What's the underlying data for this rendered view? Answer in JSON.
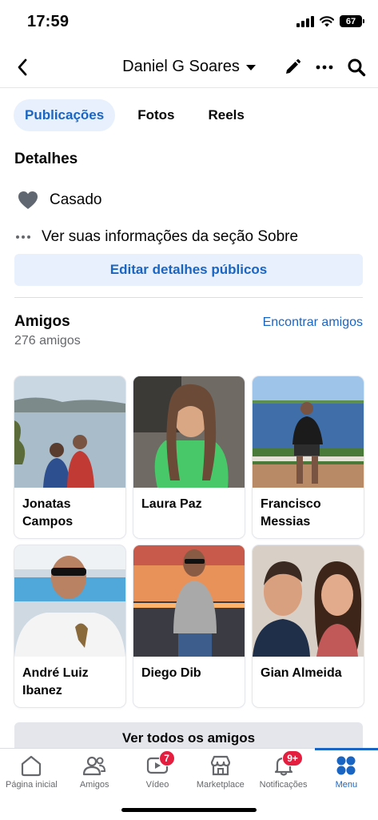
{
  "status_bar": {
    "time": "17:59",
    "battery": "67"
  },
  "header": {
    "name": "Daniel G Soares"
  },
  "tabs": [
    {
      "label": "Publicações",
      "active": true
    },
    {
      "label": "Fotos",
      "active": false
    },
    {
      "label": "Reels",
      "active": false
    }
  ],
  "details": {
    "title": "Detalhes",
    "relationship": "Casado",
    "about_link": "Ver suas informações da seção Sobre",
    "edit_button": "Editar detalhes públicos"
  },
  "friends": {
    "title": "Amigos",
    "count": "276 amigos",
    "find_link": "Encontrar amigos",
    "list": [
      {
        "name": "Jonatas Campos"
      },
      {
        "name": "Laura Paz"
      },
      {
        "name": "Francisco Messias"
      },
      {
        "name": "André Luiz Ibanez"
      },
      {
        "name": "Diego Dib"
      },
      {
        "name": "Gian Almeida"
      }
    ],
    "see_all": "Ver todos os amigos"
  },
  "bottom_nav": [
    {
      "label": "Página inicial",
      "icon": "home-icon"
    },
    {
      "label": "Amigos",
      "icon": "friends-icon"
    },
    {
      "label": "Vídeo",
      "icon": "video-icon",
      "badge": "7"
    },
    {
      "label": "Marketplace",
      "icon": "marketplace-icon"
    },
    {
      "label": "Notificações",
      "icon": "bell-icon",
      "badge": "9+"
    },
    {
      "label": "Menu",
      "icon": "menu-icon",
      "active": true
    }
  ],
  "colors": {
    "accent": "#1b65c2",
    "accent_bg": "#e7f0fc",
    "badge": "#e41e3f"
  }
}
